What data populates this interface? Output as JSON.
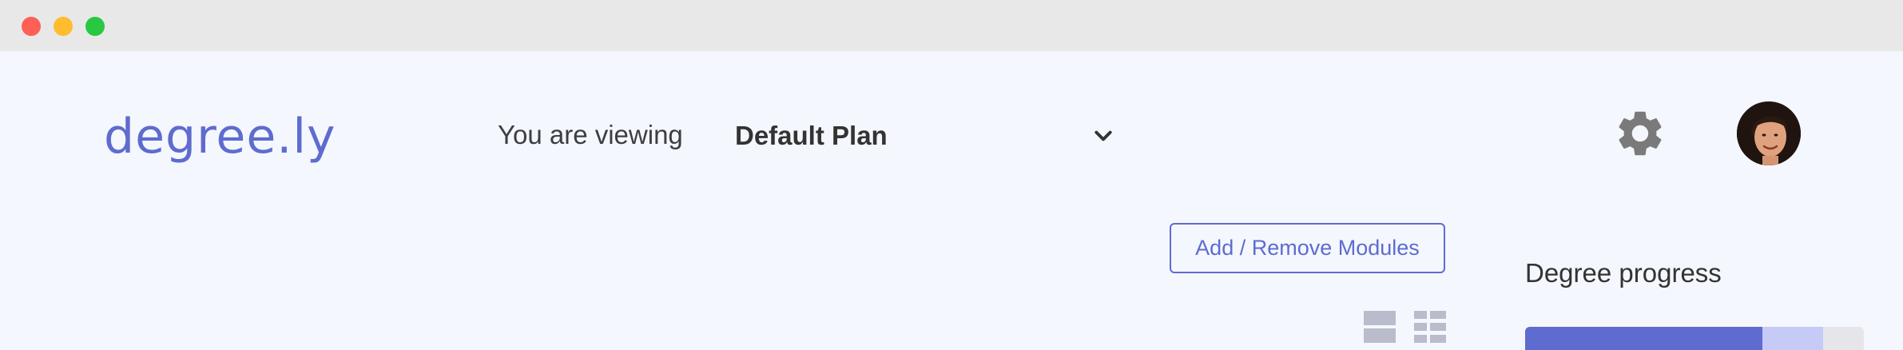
{
  "window": {
    "controls": [
      "close",
      "minimize",
      "maximize"
    ],
    "colors": {
      "close": "#fe5f57",
      "minimize": "#febc2e",
      "maximize": "#28c840"
    }
  },
  "header": {
    "logo": "degree.ly",
    "viewing_label": "You are viewing",
    "plan_select": {
      "selected": "Default Plan",
      "icon": "chevron-down-icon"
    },
    "settings_icon": "gear-icon",
    "avatar_icon": "user-avatar"
  },
  "main": {
    "add_remove_button": "Add / Remove Modules",
    "view_toggle": {
      "list_icon": "list-view-icon",
      "grid_icon": "grid-view-icon"
    }
  },
  "sidebar": {
    "progress_title": "Degree progress",
    "progress": {
      "completed": 0.7,
      "planned": 0.18
    }
  },
  "colors": {
    "accent": "#5e6ccf",
    "planned": "#c5caf6",
    "track": "#e6e6ea",
    "background": "#f4f7fd"
  }
}
